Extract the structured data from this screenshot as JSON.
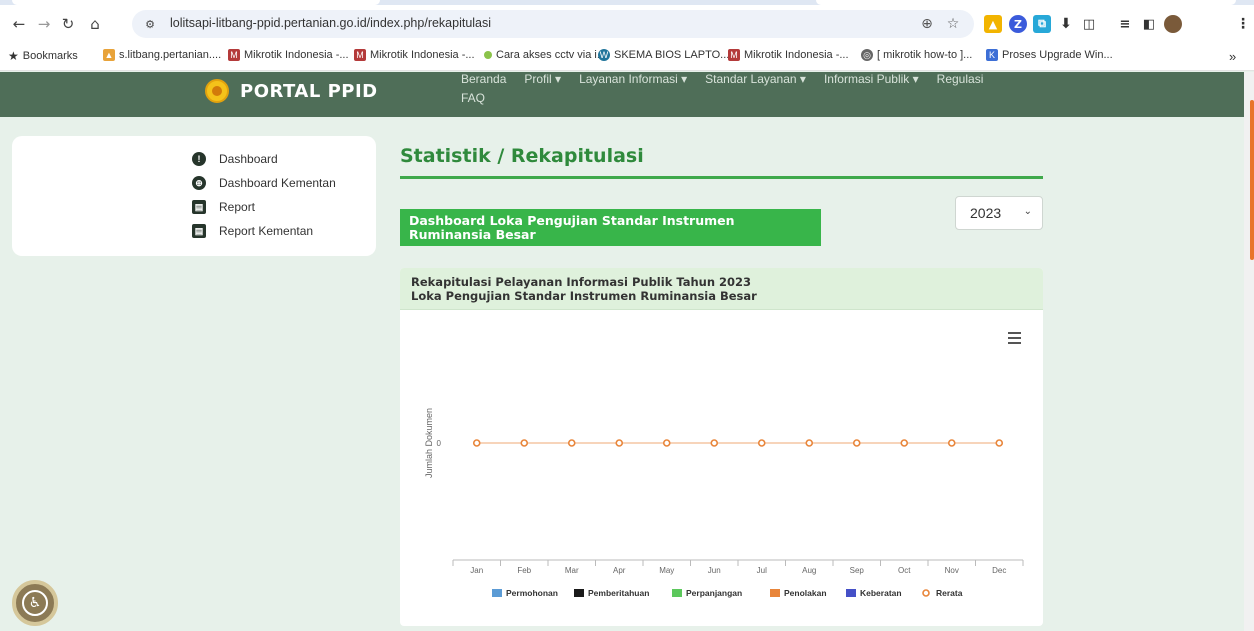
{
  "browser": {
    "url": "lolitsapi-litbang-ppid.pertanian.go.id/index.php/rekapitulasi",
    "bookmarks": [
      "Bookmarks",
      "s.litbang.pertanian....",
      "Mikrotik Indonesia -...",
      "Mikrotik Indonesia -...",
      "Cara akses cctv via i...",
      "SKEMA BIOS LAPTO...",
      "Mikrotik Indonesia -...",
      "[ mikrotik how-to ]...",
      "Proses Upgrade Win..."
    ],
    "more_bookmarks": "»"
  },
  "header": {
    "brand": "PORTAL PPID",
    "menu": [
      "Beranda",
      "Profil ▾",
      "Layanan Informasi ▾",
      "Standar Layanan ▾",
      "Informasi Publik ▾",
      "Regulasi"
    ],
    "menu_faq": "FAQ"
  },
  "sidebar": {
    "items": [
      {
        "label": "Dashboard",
        "icon": "info-icon"
      },
      {
        "label": "Dashboard Kementan",
        "icon": "globe-icon"
      },
      {
        "label": "Report",
        "icon": "book-icon"
      },
      {
        "label": "Report Kementan",
        "icon": "book-icon"
      }
    ]
  },
  "main": {
    "title": "Statistik / Rekapitulasi",
    "lab_name": "Dashboard Loka Pengujian Standar Instrumen Ruminansia Besar",
    "year": "2023"
  },
  "chart_card": {
    "title_line1": "Rekapitulasi Pelayanan Informasi Publik Tahun 2023",
    "title_line2": "Loka Pengujian Standar Instrumen Ruminansia Besar"
  },
  "chart_data": {
    "type": "line",
    "title": "Rekapitulasi Pelayanan Informasi Publik Tahun 2023",
    "subtitle": "Loka Pengujian Standar Instrumen Ruminansia Besar",
    "xlabel": "",
    "ylabel": "Jumlah Dokumen",
    "categories": [
      "Jan",
      "Feb",
      "Mar",
      "Apr",
      "May",
      "Jun",
      "Jul",
      "Aug",
      "Sep",
      "Oct",
      "Nov",
      "Dec"
    ],
    "yticks": [
      0
    ],
    "series": [
      {
        "name": "Permohonan",
        "type": "bar",
        "color": "#5b9bd5",
        "values": [
          0,
          0,
          0,
          0,
          0,
          0,
          0,
          0,
          0,
          0,
          0,
          0
        ]
      },
      {
        "name": "Pemberitahuan",
        "type": "bar",
        "color": "#1a1a1a",
        "values": [
          0,
          0,
          0,
          0,
          0,
          0,
          0,
          0,
          0,
          0,
          0,
          0
        ]
      },
      {
        "name": "Perpanjangan",
        "type": "bar",
        "color": "#5cc85c",
        "values": [
          0,
          0,
          0,
          0,
          0,
          0,
          0,
          0,
          0,
          0,
          0,
          0
        ]
      },
      {
        "name": "Penolakan",
        "type": "bar",
        "color": "#e8853a",
        "values": [
          0,
          0,
          0,
          0,
          0,
          0,
          0,
          0,
          0,
          0,
          0,
          0
        ]
      },
      {
        "name": "Keberatan",
        "type": "bar",
        "color": "#4550c7",
        "values": [
          0,
          0,
          0,
          0,
          0,
          0,
          0,
          0,
          0,
          0,
          0,
          0
        ]
      },
      {
        "name": "Rerata",
        "type": "line",
        "color": "#e8853a",
        "values": [
          0,
          0,
          0,
          0,
          0,
          0,
          0,
          0,
          0,
          0,
          0,
          0
        ]
      }
    ],
    "legend_position": "bottom"
  }
}
